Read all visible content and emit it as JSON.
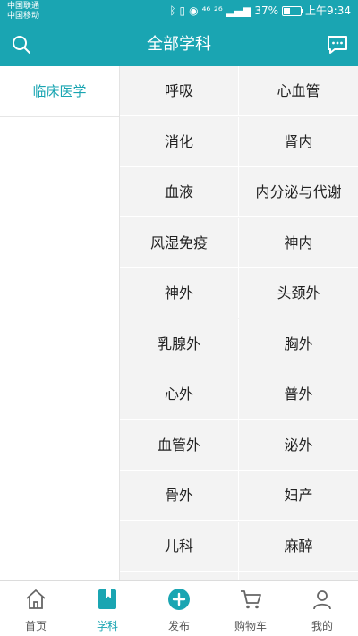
{
  "status": {
    "carrier1": "中国联通",
    "carrier2": "中国移动",
    "signal_text": "⁴⁶ ²⁶",
    "battery": "37%",
    "battery_level": 0.37,
    "time": "上午9:34"
  },
  "header": {
    "title": "全部学科"
  },
  "sidebar": {
    "items": [
      {
        "label": "临床医学"
      }
    ]
  },
  "subjects": [
    "呼吸",
    "心血管",
    "消化",
    "肾内",
    "血液",
    "内分泌与代谢",
    "风湿免疫",
    "神内",
    "神外",
    "头颈外",
    "乳腺外",
    "胸外",
    "心外",
    "普外",
    "血管外",
    "泌外",
    "骨外",
    "妇产",
    "儿科",
    "麻醉",
    "",
    ""
  ],
  "tabs": [
    {
      "label": "首页",
      "icon": "home-icon",
      "active": false
    },
    {
      "label": "学科",
      "icon": "bookmark-icon",
      "active": true
    },
    {
      "label": "发布",
      "icon": "plus-circle-icon",
      "active": false
    },
    {
      "label": "购物车",
      "icon": "cart-icon",
      "active": false
    },
    {
      "label": "我的",
      "icon": "user-icon",
      "active": false
    }
  ],
  "colors": {
    "accent": "#1aa5b2",
    "grid_bg": "#f3f3f3"
  }
}
